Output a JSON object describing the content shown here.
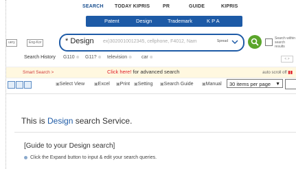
{
  "topnav": {
    "items": [
      "SEARCH",
      "TODAY KIPRIS",
      "PR",
      "GUIDE",
      "KIPRIS"
    ]
  },
  "subnav": {
    "items": [
      "Patent",
      "Design",
      "Trademark",
      "K P A"
    ]
  },
  "search": {
    "left_options": [
      "uery",
      "Eng-Kor"
    ],
    "value": "* Design",
    "placeholder": "ex)3020010012345, cellphone, F4012, Nam",
    "spread_label": "Spread",
    "within_label_1": "Search within",
    "within_label_2": "search results"
  },
  "history": {
    "label": "Search History",
    "items": [
      "G110",
      "G11?",
      "television",
      "car"
    ],
    "nav": "< >"
  },
  "smart": {
    "left": "Smart Search >",
    "middle_red": "Click here!",
    "middle_rest": " for advanced search",
    "right": "auto scroll off"
  },
  "toolbar": {
    "options": [
      "Select View",
      "Excel",
      "Print",
      "Setting",
      "Search Guide",
      "Manual"
    ],
    "per_page": "30 items per page"
  },
  "content": {
    "title_prefix": "This is ",
    "title_highlight": "Design",
    "title_suffix": " search Service.",
    "guide_heading": "[Guide to your Design search]",
    "bullet_1": "Click the Expand button to input & edit your search queries."
  },
  "colors": {
    "brand_blue": "#1d5aa6",
    "go_green": "#5aa52a",
    "accent_red": "#e0202a",
    "smart_bg": "#fff8e0"
  }
}
